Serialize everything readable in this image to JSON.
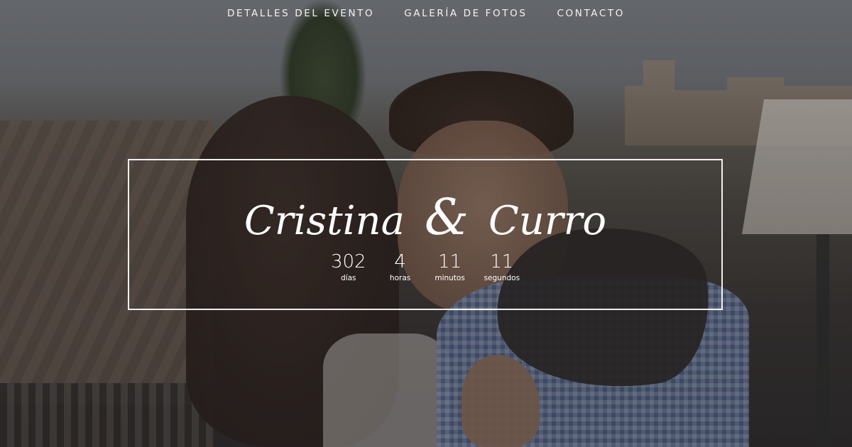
{
  "nav": {
    "items": [
      {
        "label": "DETALLES DEL EVENTO"
      },
      {
        "label": "GALERÍA DE FOTOS"
      },
      {
        "label": "CONTACTO"
      }
    ]
  },
  "hero": {
    "name_left": "Cristina",
    "ampersand": "&",
    "name_right": "Curro",
    "countdown": [
      {
        "value": "302",
        "label": "días"
      },
      {
        "value": "4",
        "label": "horas"
      },
      {
        "value": "11",
        "label": "minutos"
      },
      {
        "value": "11",
        "label": "segundos"
      }
    ]
  },
  "colors": {
    "text": "#ffffff",
    "frame": "#ffffff"
  }
}
